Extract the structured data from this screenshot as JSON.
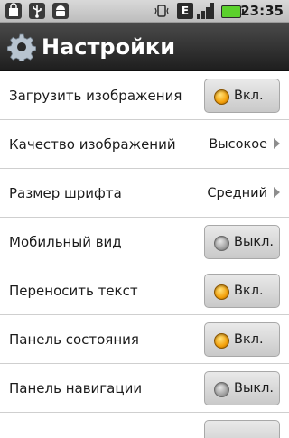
{
  "status_bar": {
    "time": "23:35",
    "network_type": "E",
    "icons": [
      "shopping-bag-icon",
      "usb-icon",
      "android-icon",
      "vibrate-icon",
      "edge-network-icon",
      "signal-icon",
      "battery-icon"
    ],
    "battery_color": "#5bd12c"
  },
  "header": {
    "title": "Настройки",
    "icon": "gear-icon",
    "background": "#2a2a2a"
  },
  "settings": {
    "items": [
      {
        "label": "Загрузить изображения",
        "type": "toggle",
        "state": "on",
        "toggle_text": "Вкл."
      },
      {
        "label": "Качество изображений",
        "type": "select",
        "value": "Высокое"
      },
      {
        "label": "Размер шрифта",
        "type": "select",
        "value": "Средний"
      },
      {
        "label": "Мобильный вид",
        "type": "toggle",
        "state": "off",
        "toggle_text": "Выкл."
      },
      {
        "label": "Переносить текст",
        "type": "toggle",
        "state": "on",
        "toggle_text": "Вкл."
      },
      {
        "label": "Панель состояния",
        "type": "toggle",
        "state": "on",
        "toggle_text": "Вкл."
      },
      {
        "label": "Панель навигации",
        "type": "toggle",
        "state": "off",
        "toggle_text": "Выкл."
      }
    ]
  },
  "colors": {
    "toggle_on": "#f4a10b",
    "toggle_off": "#9c9c9c",
    "divider": "#cfcfcf"
  }
}
